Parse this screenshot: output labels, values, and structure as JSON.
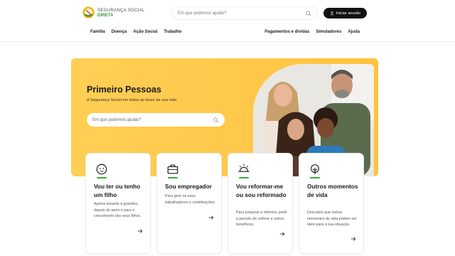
{
  "header": {
    "logo": {
      "line1": "SEGURANÇA SOCIAL",
      "line2": "DIRETA"
    },
    "search": {
      "placeholder": "Em que podemos ajudar?"
    },
    "login_label": "Iniciar sessão"
  },
  "nav": {
    "left": [
      {
        "label": "Família"
      },
      {
        "label": "Doença"
      },
      {
        "label": "Ação Social"
      },
      {
        "label": "Trabalho"
      }
    ],
    "right": [
      {
        "label": "Pagamentos e dívidas"
      },
      {
        "label": "Simuladores"
      },
      {
        "label": "Ajuda"
      }
    ]
  },
  "hero": {
    "title": "Primeiro Pessoas",
    "subtitle": "A Segurança Social em todas as fases da sua vida.",
    "search": {
      "placeholder": "Em que podemos ajudar?"
    }
  },
  "cards": [
    {
      "title": "Vou ter ou tenho um filho",
      "desc": "Apoios durante a gravidez, depois do parto e para o crescimento dos seus filhos.",
      "icon": "baby-icon"
    },
    {
      "title": "Sou empregador",
      "desc": "Para gerir os seus trabalhadores e contribuições.",
      "icon": "briefcase-icon"
    },
    {
      "title": "Vou reformar-me ou sou reformado",
      "desc": "Para preparar a reforma, pedir a pensão de velhice e outros benefícios.",
      "icon": "sunset-icon"
    },
    {
      "title": "Outros momentos de vida",
      "desc": "Descubra que outros momentos de vida podem ser úteis para a sua situação.",
      "icon": "tree-icon"
    }
  ],
  "colors": {
    "hero_yellow": "#ffc84a",
    "accent_green": "#3aa63a",
    "button_dark": "#111111"
  }
}
